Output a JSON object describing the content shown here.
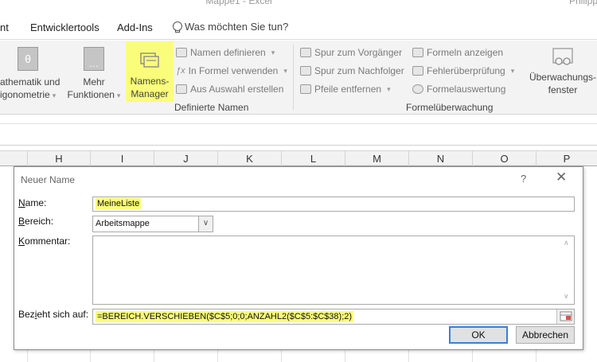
{
  "app": {
    "window_title": "Mappe1 - Excel",
    "user": "Philipp"
  },
  "menu": {
    "tabs": [
      "nt",
      "Entwicklertools",
      "Add-Ins"
    ],
    "tell_me": "Was möchten Sie tun?"
  },
  "ribbon": {
    "math": {
      "line1": "athematik und",
      "line2": "igonometrie"
    },
    "more": {
      "line1": "Mehr",
      "line2": "Funktionen"
    },
    "names_manager": {
      "line1": "Namens-",
      "line2": "Manager"
    },
    "define_name": "Namen definieren",
    "use_in_formula": "In Formel verwenden",
    "create_from_selection": "Aus Auswahl erstellen",
    "defined_names_group": "Definierte Namen",
    "trace_precedents": "Spur zum Vorgänger",
    "trace_dependents": "Spur zum Nachfolger",
    "remove_arrows": "Pfeile entfernen",
    "show_formulas": "Formeln anzeigen",
    "error_checking": "Fehlerüberprüfung",
    "evaluate_formula": "Formelauswertung",
    "formula_auditing_group": "Formelüberwachung",
    "watch_window": {
      "line1": "Überwachungs-",
      "line2": "fenster"
    }
  },
  "columns": [
    "H",
    "I",
    "J",
    "K",
    "L",
    "M",
    "N",
    "O",
    "P"
  ],
  "dialog": {
    "title": "Neuer Name",
    "help": "?",
    "close": "✕",
    "name_label_u": "N",
    "name_label_rest": "ame:",
    "name_value": "MeineListe",
    "scope_label_u": "B",
    "scope_label_rest": "ereich:",
    "scope_value": "Arbeitsmappe",
    "comment_label_u": "K",
    "comment_label_rest": "ommentar:",
    "comment_value": "",
    "refers_label_pre": "Bez",
    "refers_label_u": "i",
    "refers_label_rest": "eht sich auf:",
    "refers_value": "=BEREICH.VERSCHIEBEN($C$5;0;0;ANZAHL2($C$5:$C$38);2)",
    "ok": "OK",
    "cancel": "Abbrechen"
  },
  "colors": {
    "highlight": "#fafd7a",
    "ribbon_bg": "#f3f3f3",
    "default_button_border": "#3c7fd9"
  }
}
